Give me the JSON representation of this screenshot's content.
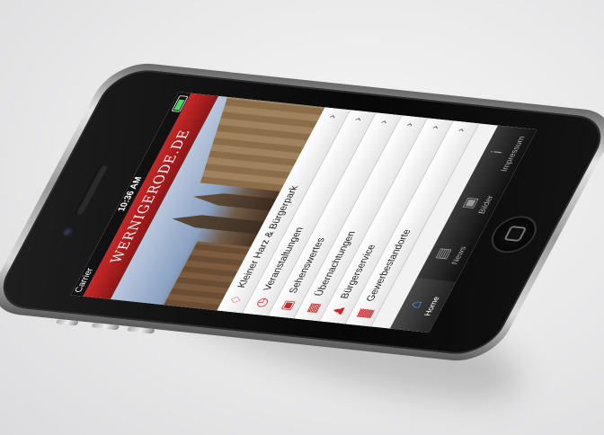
{
  "status": {
    "carrier": "Carrier",
    "time": "10:36 AM"
  },
  "app": {
    "title": "WERNIGERODE.DE"
  },
  "menu": [
    {
      "label": "Kleiner Harz & Bürgerpark",
      "icon": "goblet-icon"
    },
    {
      "label": "Veranstaltungen",
      "icon": "clock-icon"
    },
    {
      "label": "Sehenswertes",
      "icon": "camera-icon"
    },
    {
      "label": "Übernachtungen",
      "icon": "bed-icon"
    },
    {
      "label": "Bürgerservice",
      "icon": "people-icon"
    },
    {
      "label": "Gewerbestandorte",
      "icon": "factory-icon"
    }
  ],
  "tabs": [
    {
      "label": "Home",
      "icon": "home-icon"
    },
    {
      "label": "News",
      "icon": "news-icon"
    },
    {
      "label": "Bilder",
      "icon": "photos-icon"
    },
    {
      "label": "Impressum",
      "icon": "info-icon"
    }
  ],
  "colors": {
    "brand": "#c62828",
    "tab_active": "#4ea3ff"
  }
}
